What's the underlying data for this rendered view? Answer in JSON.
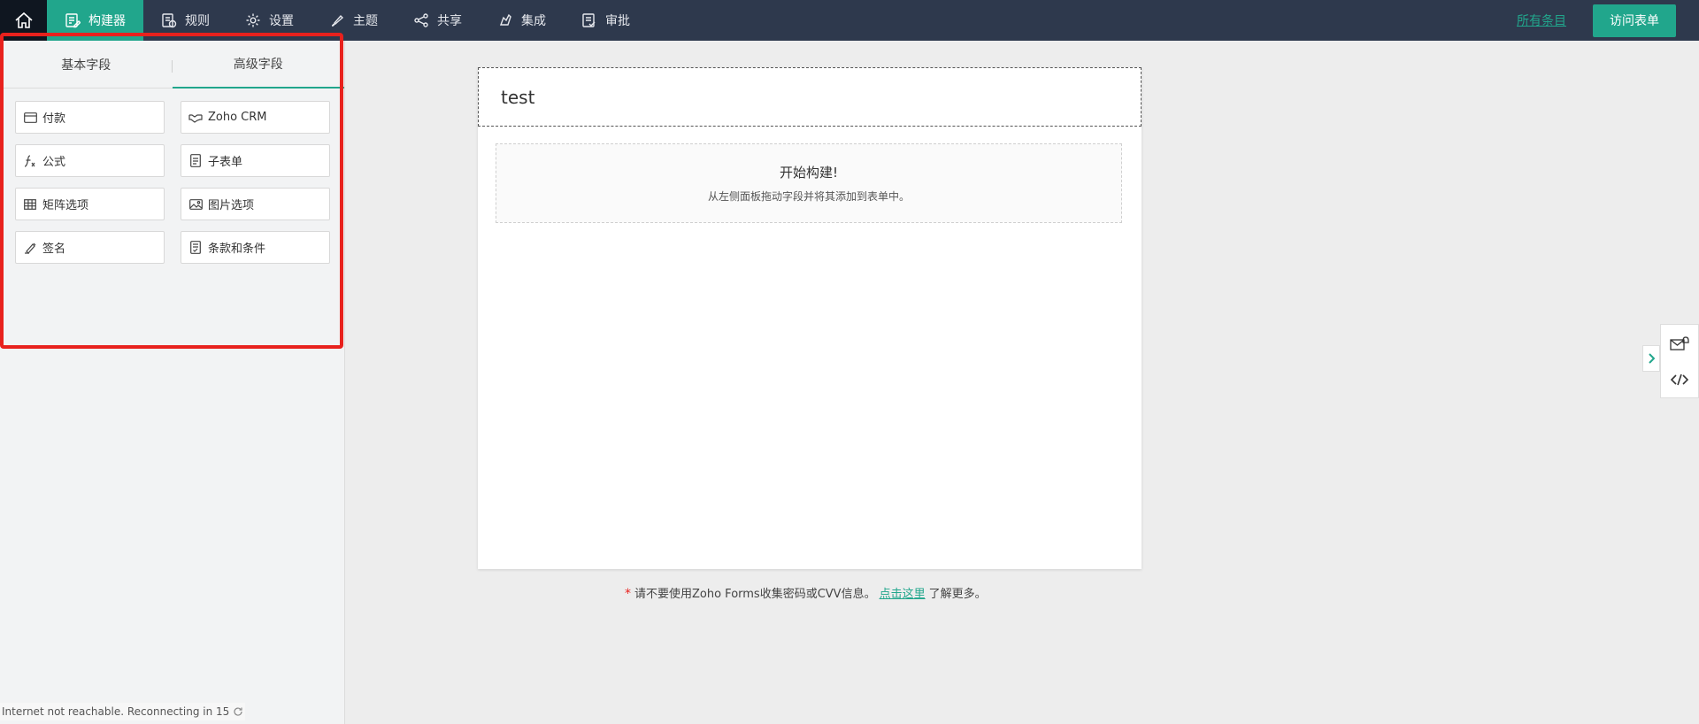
{
  "topbar": {
    "nav": [
      {
        "label": "构建器",
        "icon": "builder-icon",
        "active": true
      },
      {
        "label": "规则",
        "icon": "rules-icon"
      },
      {
        "label": "设置",
        "icon": "gear-icon"
      },
      {
        "label": "主题",
        "icon": "brush-icon"
      },
      {
        "label": "共享",
        "icon": "share-icon"
      },
      {
        "label": "集成",
        "icon": "integration-icon"
      },
      {
        "label": "审批",
        "icon": "approval-icon"
      }
    ],
    "all_entries": "所有条目",
    "visit_form": "访问表单"
  },
  "left_panel": {
    "tabs": [
      "基本字段",
      "高级字段"
    ],
    "active_tab": "高级字段",
    "fields": [
      {
        "label": "付款",
        "icon": "card-icon"
      },
      {
        "label": "Zoho CRM",
        "icon": "handshake-icon"
      },
      {
        "label": "公式",
        "icon": "formula-icon"
      },
      {
        "label": "子表单",
        "icon": "subform-icon"
      },
      {
        "label": "矩阵选项",
        "icon": "matrix-icon"
      },
      {
        "label": "图片选项",
        "icon": "image-icon"
      },
      {
        "label": "签名",
        "icon": "pen-icon"
      },
      {
        "label": "条款和条件",
        "icon": "terms-icon"
      }
    ]
  },
  "form": {
    "title": "test",
    "drop_title": "开始构建!",
    "drop_subtitle": "从左侧面板拖动字段并将其添加到表单中。"
  },
  "footer": {
    "star": "*",
    "text_before": "请不要使用Zoho Forms收集密码或CVV信息。",
    "link": "点击这里",
    "text_after": "了解更多。"
  },
  "status_bar": {
    "text": "Internet not reachable. Reconnecting in 15"
  },
  "colors": {
    "topbar": "#2e394d",
    "accent": "#21a68c",
    "highlight": "#e8211d"
  }
}
